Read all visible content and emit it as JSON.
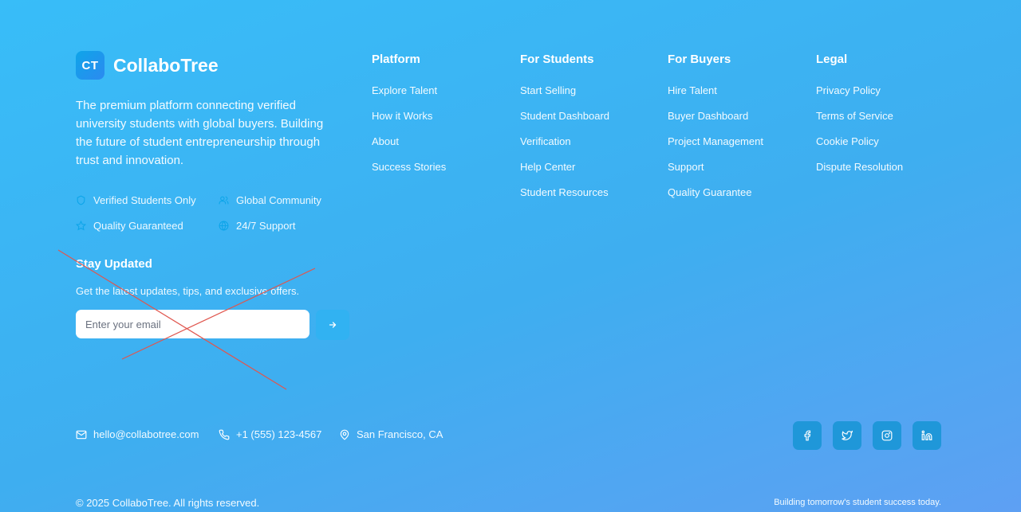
{
  "brand": {
    "logo_text": "CT",
    "name": "CollaboTree",
    "tagline": "The premium platform connecting verified university students with global buyers. Building the future of student entrepreneurship through trust and innovation."
  },
  "features": [
    {
      "label": "Verified Students Only",
      "icon": "shield-icon"
    },
    {
      "label": "Global Community",
      "icon": "users-icon"
    },
    {
      "label": "Quality Guaranteed",
      "icon": "star-icon"
    },
    {
      "label": "24/7 Support",
      "icon": "globe-icon"
    }
  ],
  "newsletter": {
    "title": "Stay Updated",
    "description": "Get the latest updates, tips, and exclusive offers.",
    "placeholder": "Enter your email",
    "submit_icon": "arrow-right-icon"
  },
  "columns": [
    {
      "title": "Platform",
      "links": [
        "Explore Talent",
        "How it Works",
        "About",
        "Success Stories"
      ]
    },
    {
      "title": "For Students",
      "links": [
        "Start Selling",
        "Student Dashboard",
        "Verification",
        "Help Center",
        "Student Resources"
      ]
    },
    {
      "title": "For Buyers",
      "links": [
        "Hire Talent",
        "Buyer Dashboard",
        "Project Management",
        "Support",
        "Quality Guarantee"
      ]
    },
    {
      "title": "Legal",
      "links": [
        "Privacy Policy",
        "Terms of Service",
        "Cookie Policy",
        "Dispute Resolution"
      ]
    }
  ],
  "contact": {
    "email": "hello@collabotree.com",
    "phone": "+1 (555) 123-4567",
    "location": "San Francisco, CA"
  },
  "social": [
    "facebook-icon",
    "twitter-icon",
    "instagram-icon",
    "linkedin-icon"
  ],
  "footer": {
    "copyright": "© 2025 CollaboTree. All rights reserved.",
    "slogan": "Building tomorrow's student success today."
  },
  "colors": {
    "background_start": "#38bdf8",
    "background_end": "#5ea0f3",
    "icon_accent": "#0ea5e9",
    "social_button": "#1f97d9",
    "annotation_cross": "#e0564e"
  }
}
